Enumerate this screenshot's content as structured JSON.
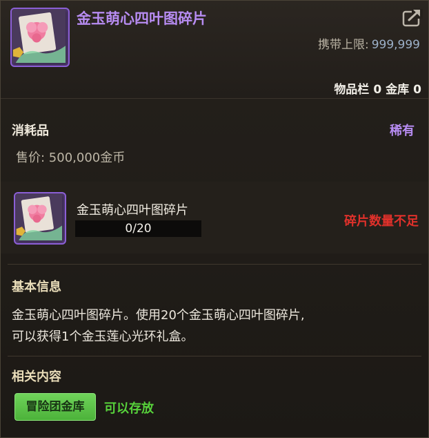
{
  "item": {
    "name": "金玉萌心四叶图碎片",
    "icon": "four-leaf-fragment-icon",
    "carry_label": "携带上限:",
    "carry_value": "999,999",
    "inventory_label": "物品栏",
    "inventory_count": "0",
    "vault_label": "金库",
    "vault_count": "0",
    "category": "消耗品",
    "rarity": "稀有",
    "price": "售价: 500,000金币"
  },
  "material": {
    "name": "金玉萌心四叶图碎片",
    "progress_text": "0/20",
    "progress_fraction": 0,
    "status": "碎片数量不足"
  },
  "basic_info": {
    "title": "基本信息",
    "line1": "金玉萌心四叶图碎片。使用20个金玉萌心四叶图碎片,",
    "line2": "可以获得1个金玉莲心光环礼盒。"
  },
  "related": {
    "title": "相关内容",
    "button_label": "冒险团金库",
    "status": "可以存放"
  },
  "colors": {
    "rarity_purple": "#b78cf2",
    "warning_red": "#e0312b",
    "ok_green": "#57d23b"
  },
  "icons": {
    "share": "share-external-icon"
  }
}
